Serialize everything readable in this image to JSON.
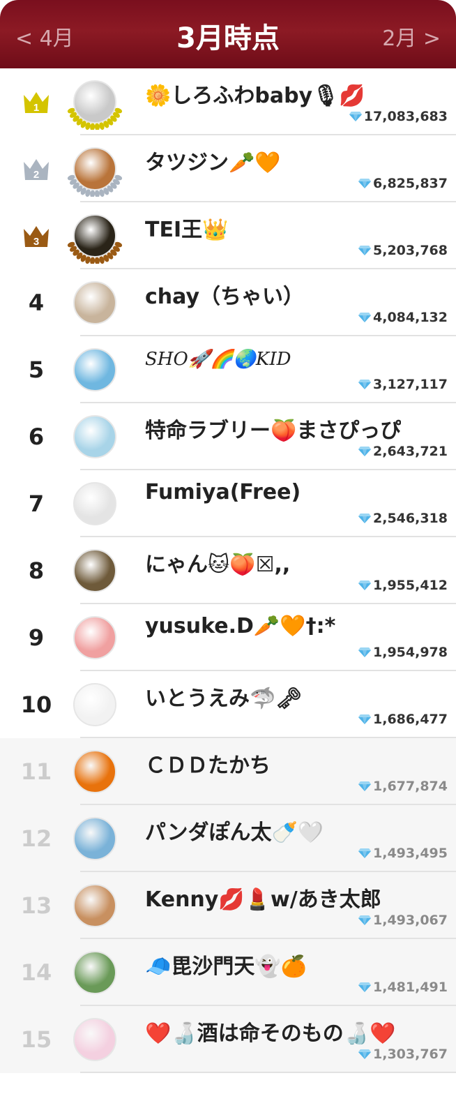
{
  "header": {
    "prev_label": "< 4月",
    "title": "3月時点",
    "next_label": "2月 >"
  },
  "colors": {
    "header_bg": "#7a0f1e",
    "gold": "#d4c400",
    "silver": "#aab4c0",
    "bronze": "#9a5a14",
    "diamond": "#4fb3e8"
  },
  "rankings": [
    {
      "rank": "1",
      "name": "🌼しろふわbaby🎙💋",
      "score": "17,083,683",
      "avatar_color": "#c9c9c9",
      "medal": "gold",
      "style": "normal"
    },
    {
      "rank": "2",
      "name": "タツジン🥕🧡",
      "score": "6,825,837",
      "avatar_color": "#b9743a",
      "medal": "silver",
      "style": "normal"
    },
    {
      "rank": "3",
      "name": "TEI王👑",
      "score": "5,203,768",
      "avatar_color": "#2a2418",
      "medal": "bronze",
      "style": "normal"
    },
    {
      "rank": "4",
      "name": "chay（ちゃい）",
      "score": "4,084,132",
      "avatar_color": "#c8b49c",
      "medal": "",
      "style": "normal"
    },
    {
      "rank": "5",
      "name": "SHO🚀🌈🌏KID",
      "score": "3,127,117",
      "avatar_color": "#6fb7e0",
      "medal": "",
      "style": "italic"
    },
    {
      "rank": "6",
      "name": "特命ラブリー🍑まさぴっぴ",
      "score": "2,643,721",
      "avatar_color": "#a8d4e8",
      "medal": "",
      "style": "normal"
    },
    {
      "rank": "7",
      "name": "Fumiya(Free)",
      "score": "2,546,318",
      "avatar_color": "#e4e4e4",
      "medal": "",
      "style": "normal"
    },
    {
      "rank": "8",
      "name": "にゃん🐱🍑☒,,",
      "score": "1,955,412",
      "avatar_color": "#6e5a3a",
      "medal": "",
      "style": "normal"
    },
    {
      "rank": "9",
      "name": "yusuke.D🥕🧡†:*",
      "score": "1,954,978",
      "avatar_color": "#f0a0a0",
      "medal": "",
      "style": "normal"
    },
    {
      "rank": "10",
      "name": "いとうえみ🦈🗝",
      "score": "1,686,477",
      "avatar_color": "#f2f2f2",
      "medal": "",
      "style": "normal"
    },
    {
      "rank": "11",
      "name": "ＣＤＤたかち",
      "score": "1,677,874",
      "avatar_color": "#e8720c",
      "medal": "",
      "style": "normal"
    },
    {
      "rank": "12",
      "name": "パンダぽん太🍼🤍",
      "score": "1,493,495",
      "avatar_color": "#7ab2d8",
      "medal": "",
      "style": "normal"
    },
    {
      "rank": "13",
      "name": "Kenny💋💄w/あき太郎",
      "score": "1,493,067",
      "avatar_color": "#c89060",
      "medal": "",
      "style": "normal"
    },
    {
      "rank": "14",
      "name": "🧢毘沙門天👻🍊",
      "score": "1,481,491",
      "avatar_color": "#6a9a58",
      "medal": "",
      "style": "normal"
    },
    {
      "rank": "15",
      "name": "❤️🍶酒は命そのもの🍶❤️",
      "score": "1,303,767",
      "avatar_color": "#f4d0e0",
      "medal": "",
      "style": "normal"
    }
  ]
}
